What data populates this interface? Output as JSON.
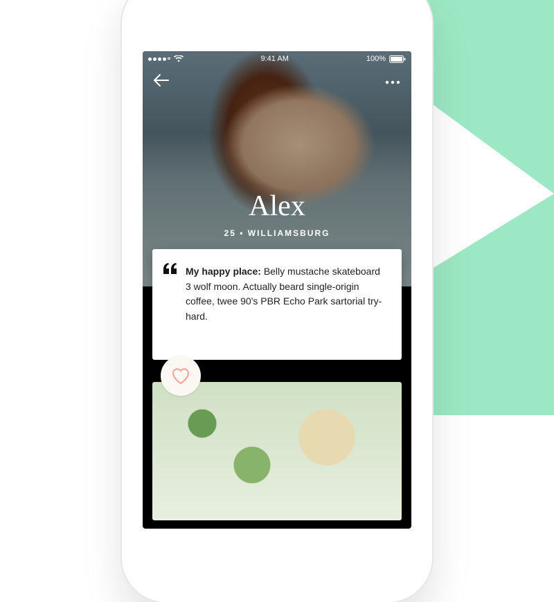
{
  "statusbar": {
    "time": "9:41 AM",
    "battery": "100%"
  },
  "profile": {
    "name": "Alex",
    "age": "25",
    "location": "WILLIAMSBURG",
    "separator": "•"
  },
  "card": {
    "prompt_label": "My happy place:",
    "prompt_answer": "Belly mustache skateboard 3 wolf moon. Actually beard single-origin coffee, twee 90's PBR Echo Park sartorial try-hard."
  }
}
